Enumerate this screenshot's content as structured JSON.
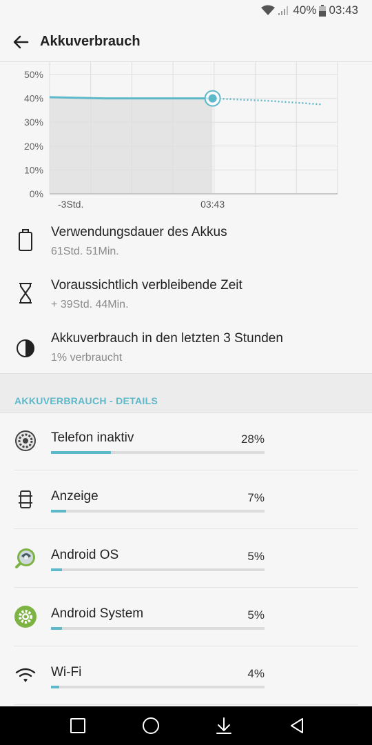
{
  "status": {
    "battery_pct": "40%",
    "time": "03:43"
  },
  "header": {
    "title": "Akkuverbrauch"
  },
  "chart_data": {
    "type": "area",
    "ytick_labels": [
      "50%",
      "40%",
      "30%",
      "20%",
      "10%",
      "0%"
    ],
    "xtick_labels": [
      "-3Std.",
      "03:43"
    ],
    "ylim": [
      0,
      50
    ],
    "series": [
      {
        "values_x": [
          -3,
          -2,
          -1,
          0
        ],
        "values_y": [
          40.5,
          40,
          40,
          40
        ]
      },
      {
        "values_x": [
          0,
          1,
          2
        ],
        "values_y": [
          40,
          39,
          37.5
        ],
        "style": "dotted-projection"
      }
    ],
    "current_marker": {
      "x": 0,
      "y": 40
    },
    "grid": true,
    "colors": {
      "line": "#5db8c9",
      "fill": "#e4e4e4"
    }
  },
  "info": [
    {
      "title": "Verwendungsdauer des Akkus",
      "subtitle": "61Std. 51Min.",
      "icon": "battery-icon"
    },
    {
      "title": "Voraussichtlich verbleibende Zeit",
      "subtitle": "+ 39Std. 44Min.",
      "icon": "hourglass-icon"
    },
    {
      "title": "Akkuverbrauch in den letzten 3 Stunden",
      "subtitle": "1% verbraucht",
      "icon": "half-circle-icon"
    }
  ],
  "section": {
    "title": "AKKUVERBRAUCH - DETAILS"
  },
  "usage": [
    {
      "label": "Telefon inaktiv",
      "percent": "28%",
      "fraction": 0.28,
      "icon": "settings-gear-icon"
    },
    {
      "label": "Anzeige",
      "percent": "7%",
      "fraction": 0.07,
      "icon": "phone-display-icon"
    },
    {
      "label": "Android OS",
      "percent": "5%",
      "fraction": 0.05,
      "icon": "android-os-icon"
    },
    {
      "label": "Android System",
      "percent": "5%",
      "fraction": 0.05,
      "icon": "android-system-gear-icon"
    },
    {
      "label": "Wi-Fi",
      "percent": "4%",
      "fraction": 0.04,
      "icon": "wifi-icon"
    }
  ],
  "colors": {
    "accent": "#5db8c9",
    "android_green": "#7cb342"
  }
}
